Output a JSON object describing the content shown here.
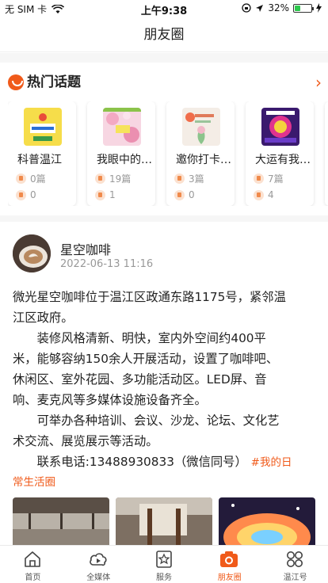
{
  "status_bar": {
    "carrier": "无 SIM 卡",
    "time": "上午9:38",
    "battery": "32%",
    "battery_level": 0.32
  },
  "nav": {
    "title": "朋友圈"
  },
  "hot_topics": {
    "title": "热门话题",
    "items": [
      {
        "name": "科普温江",
        "posts": "0篇",
        "likes": "0",
        "thumb_icon": "science-poster-icon"
      },
      {
        "name": "我眼中的…",
        "posts": "19篇",
        "likes": "1",
        "thumb_icon": "spring-blossom-icon"
      },
      {
        "name": "邀你打卡…",
        "posts": "3篇",
        "likes": "0",
        "thumb_icon": "flower-poster-icon"
      },
      {
        "name": "大运有我…",
        "posts": "7篇",
        "likes": "4",
        "thumb_icon": "universiade-poster-icon"
      }
    ]
  },
  "post": {
    "author": "星空咖啡",
    "time": "2022-06-13 11:16",
    "lines": [
      "微光星空咖啡位于温江区政通东路1175号，紧邻温",
      "江区政府。",
      "　　装修风格清新、明快，室内外空间约400平",
      "米，能够容纳150余人开展活动，设置了咖啡吧、",
      "休闲区、室外花园、多功能活动区。LED屏、音",
      "响、麦克风等多媒体设施设备齐全。",
      "　　可举办各种培训、会议、沙龙、论坛、文化艺",
      "术交流、展览展示等活动。",
      "　　联系电话:13488930833（微信同号）"
    ],
    "hashtag_a": "#我的日",
    "hashtag_b": "常生活圈"
  },
  "tabs": [
    {
      "label": "首页",
      "icon": "home-icon"
    },
    {
      "label": "全媒体",
      "icon": "media-play-icon"
    },
    {
      "label": "服务",
      "icon": "star-service-icon"
    },
    {
      "label": "朋友圈",
      "icon": "camera-icon",
      "active": true
    },
    {
      "label": "温江号",
      "icon": "grid-icon"
    }
  ],
  "colors": {
    "accent": "#f05a1a",
    "muted": "#999999"
  }
}
